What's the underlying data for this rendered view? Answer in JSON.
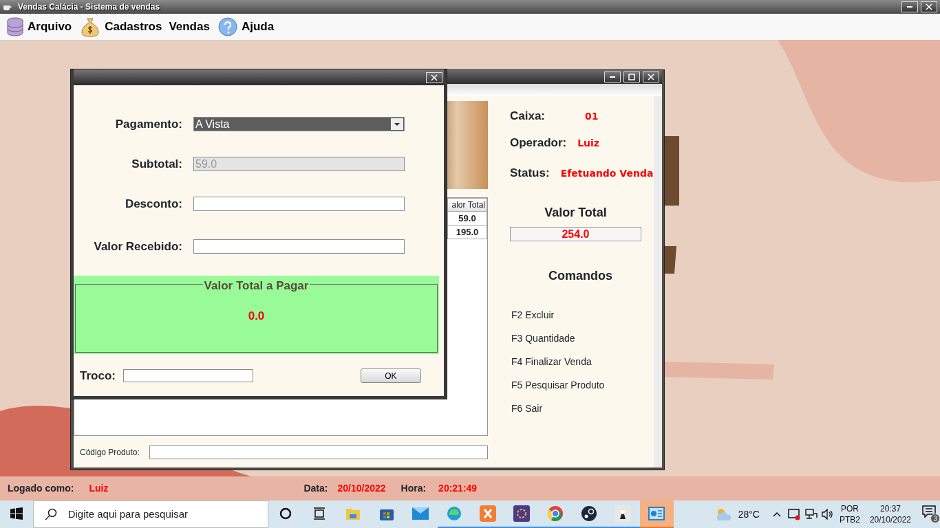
{
  "app_window": {
    "title": "Vendas Calácia - Sistema de vendas"
  },
  "menu": [
    {
      "label": "Arquivo"
    },
    {
      "label": "Cadastros"
    },
    {
      "label": "Vendas"
    },
    {
      "label": "Ajuda"
    }
  ],
  "sales_window": {
    "table": {
      "columns": [
        "alor Total"
      ],
      "rows": [
        [
          "59.0"
        ],
        [
          "195.0"
        ]
      ]
    },
    "info": [
      {
        "label": "Caixa:",
        "value": "01"
      },
      {
        "label": "Operador:",
        "value": "Luiz"
      },
      {
        "label": "Status:",
        "value": "Efetuando Venda"
      }
    ],
    "total_label": "Valor Total",
    "total": "254.0",
    "commands_title": "Comandos",
    "commands": [
      "F2 Excluir",
      "F3 Quantidade",
      "F4 Finalizar Venda",
      "F5 Pesquisar Produto",
      "F6 Sair"
    ],
    "product_code_label": "Código Produto:"
  },
  "payment_dialog": {
    "fields": [
      {
        "label": "Pagamento:",
        "kind": "select",
        "value": "A Vista",
        "disabled": false
      },
      {
        "label": "Subtotal:",
        "kind": "input",
        "value": "59.0",
        "disabled": true
      },
      {
        "label": "Desconto:",
        "kind": "input",
        "disabled": false
      },
      {
        "label": "Valor Recebido:",
        "kind": "input",
        "disabled": false
      }
    ],
    "total_title": "Valor Total a Pagar",
    "total": "0.0",
    "change_label": "Troco:",
    "ok": "OK"
  },
  "status_bar": {
    "user_label": "Logado como:",
    "user": "Luiz",
    "date_label": "Data:",
    "date": "20/10/2022",
    "time_label": "Hora:",
    "time": "20:21:49"
  },
  "taskbar": {
    "search_placeholder": "Digite aqui para pesquisar",
    "apps": [
      {
        "running": false,
        "selected": false
      },
      {
        "running": false,
        "selected": false
      },
      {
        "running": false,
        "selected": false
      },
      {
        "running": false,
        "selected": false
      },
      {
        "running": false,
        "selected": false
      },
      {
        "running": true,
        "selected": false
      },
      {
        "running": true,
        "selected": false
      },
      {
        "running": true,
        "selected": false
      },
      {
        "running": true,
        "selected": false
      },
      {
        "running": true,
        "selected": false
      },
      {
        "running": true,
        "selected": false
      },
      {
        "running": false,
        "selected": true
      }
    ],
    "temperature": "28°C",
    "language": "POR",
    "layout": "PTB2",
    "time": "20:37",
    "date": "20/10/2022",
    "notifications": "3"
  }
}
